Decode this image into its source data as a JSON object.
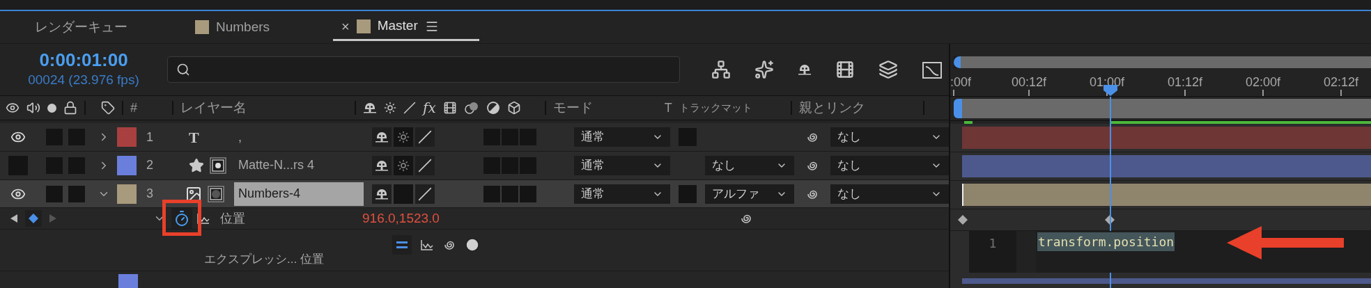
{
  "tabs": [
    {
      "label": "レンダーキュー",
      "selected": false
    },
    {
      "label": "Numbers",
      "selected": false,
      "color": "#a89a7c"
    },
    {
      "label": "Master",
      "selected": true,
      "color": "#a89a7c",
      "close": "×"
    }
  ],
  "timecode": "0:00:01:00",
  "frame_info": "00024 (23.976 fps)",
  "ruler": {
    "labels": [
      ":00f",
      "00:12f",
      "01:00f",
      "01:12f",
      "02:00f",
      "02:12f"
    ]
  },
  "columns": {
    "number": "#",
    "layer_name": "レイヤー名",
    "fx": "fx",
    "mode": "モード",
    "preserve_transparency": "T",
    "track_matte": "トラックマット",
    "parent": "親とリンク"
  },
  "layers": [
    {
      "number": "1",
      "color": "#a8403f",
      "kind": "text",
      "glyph": "T",
      "name": ",",
      "visible": true,
      "expanded": false,
      "selected": false,
      "collapse": true,
      "mode": "通常",
      "preserve_transparency_box": true,
      "parent": "なし"
    },
    {
      "number": "2",
      "color": "#6a7fdc",
      "kind": "shape",
      "name": "Matte-N...rs 4",
      "visible": false,
      "expanded": false,
      "selected": false,
      "collapse": true,
      "mode": "通常",
      "preserve_transparency_box": false,
      "track_matte": "なし",
      "parent": "なし"
    },
    {
      "number": "3",
      "color": "#a89a7c",
      "kind": "footage",
      "name": "Numbers-4",
      "visible": true,
      "expanded": true,
      "selected": true,
      "collapse": false,
      "mode": "通常",
      "preserve_transparency_box": true,
      "track_matte": "アルファ",
      "parent": "なし"
    }
  ],
  "property": {
    "name": "位置",
    "value": "916.0,1523.0",
    "stopwatch_on": true,
    "keyframe_at_current": true
  },
  "expression": {
    "label": "エクスプレッシ... 位置",
    "line_number": "1",
    "code": "transform.position",
    "enabled": true
  },
  "next_layer": {
    "color": "#6a7fdc"
  }
}
